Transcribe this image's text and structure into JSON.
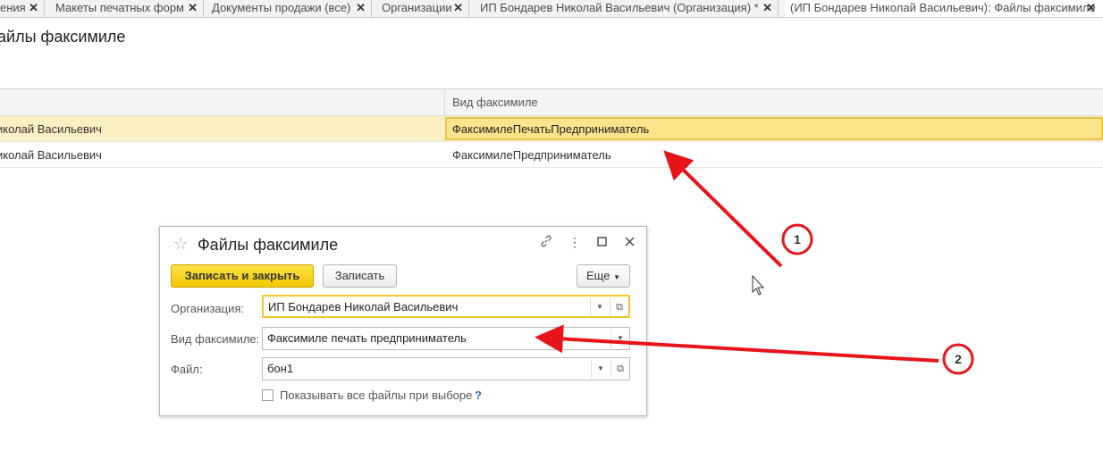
{
  "tabs": [
    {
      "label": "ения"
    },
    {
      "label": "Макеты печатных форм"
    },
    {
      "label": "Документы продажи (все)"
    },
    {
      "label": "Организации"
    },
    {
      "label": "ИП Бондарев Николай Васильевич (Организация) *"
    },
    {
      "label": "(ИП Бондарев Николай Васильевич): Файлы факсимиле"
    }
  ],
  "tab_close_glyph": "✕",
  "page": {
    "title": "айлы факсимиле"
  },
  "grid": {
    "column_b_header": "Вид факсимиле",
    "rows": [
      {
        "a": "иколай Васильевич",
        "b": "ФаксимилеПечатьПредприниматель",
        "selected": true
      },
      {
        "a": "иколай Васильевич",
        "b": "ФаксимилеПредприниматель",
        "selected": false
      }
    ]
  },
  "dialog": {
    "title": "Файлы факсимиле",
    "icons": {
      "star": "star-icon",
      "link": "link-icon",
      "more": "more-icon",
      "maximize": "maximize-icon",
      "close": "close-icon"
    },
    "buttons": {
      "save_close": "Записать и закрыть",
      "save": "Записать",
      "more": "Еще"
    },
    "fields": {
      "organization": {
        "label": "Организация:",
        "value": "ИП Бондарев Николай Васильевич"
      },
      "facsimile_type": {
        "label": "Вид факсимиле:",
        "value": "Факсимиле печать предприниматель"
      },
      "file": {
        "label": "Файл:",
        "value": "бон1"
      }
    },
    "checkbox": {
      "label": "Показывать все файлы при выборе",
      "checked": false
    },
    "help": "?"
  },
  "annotations": [
    {
      "number": "1",
      "color": "#e8141c"
    },
    {
      "number": "2",
      "color": "#e8141c"
    }
  ]
}
